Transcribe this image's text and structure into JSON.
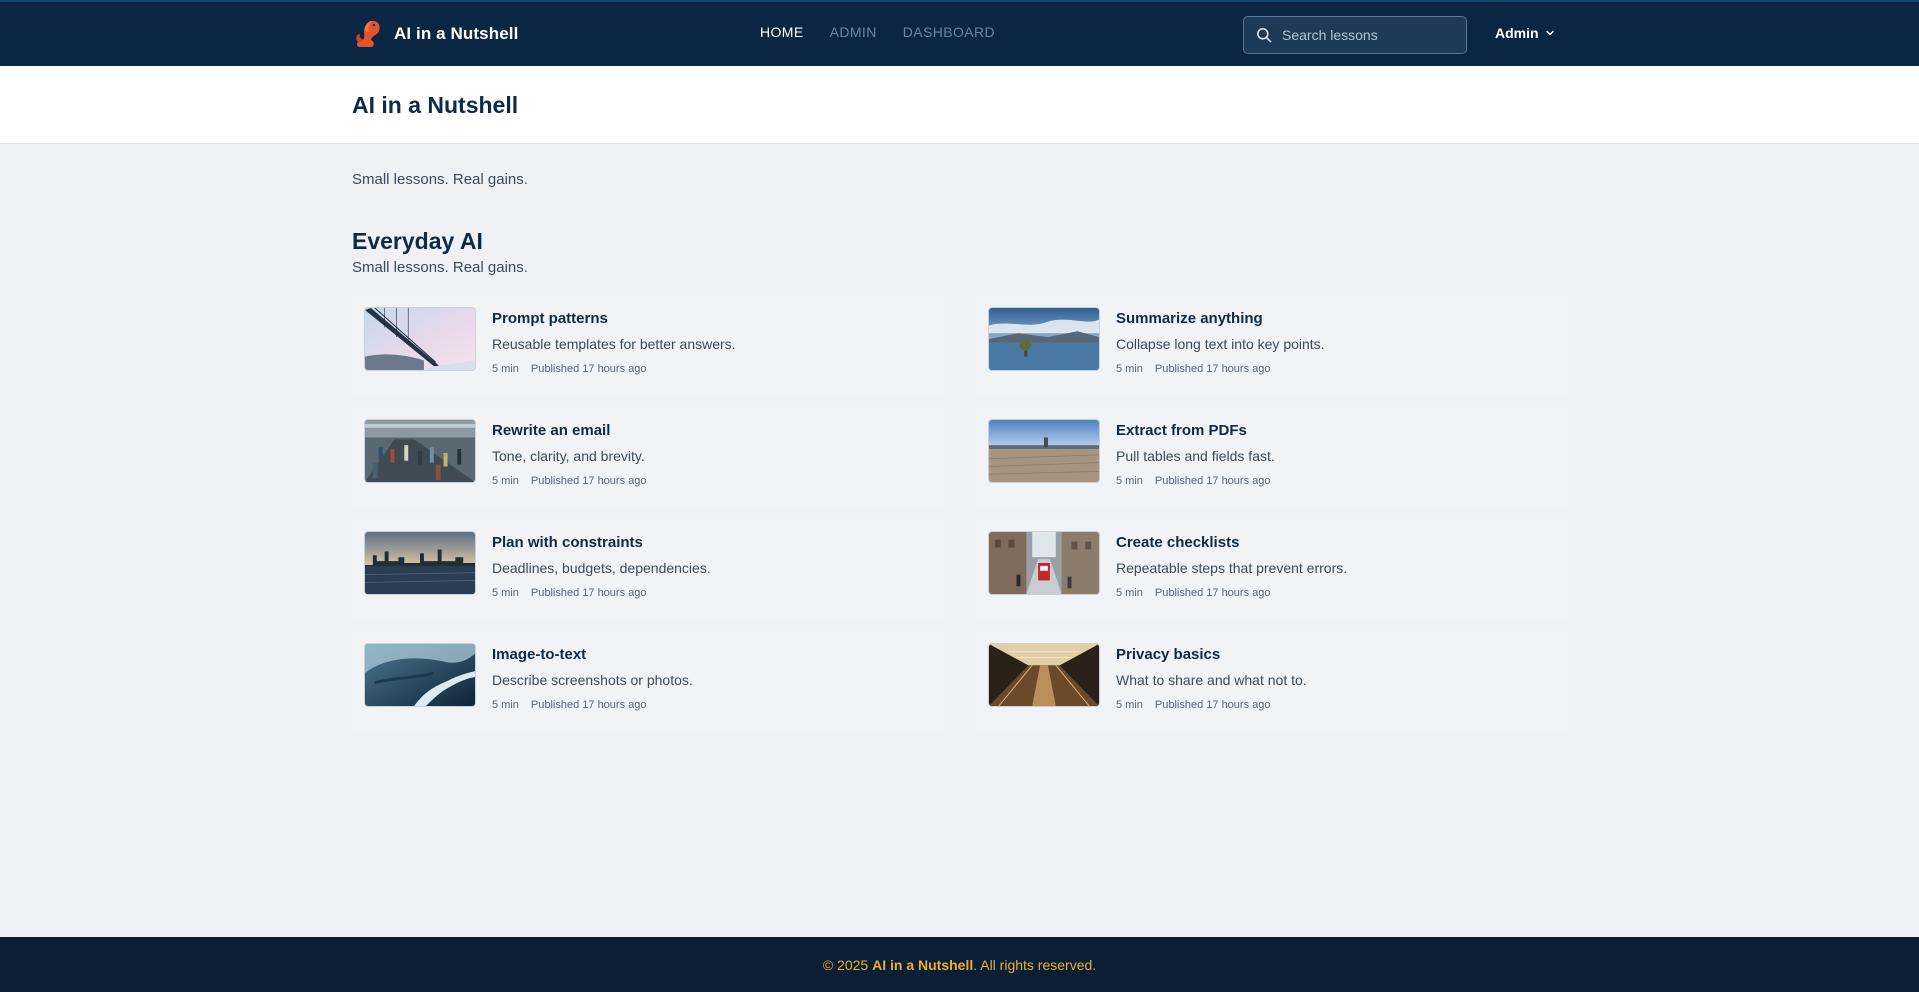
{
  "header": {
    "brand_name": "AI in a Nutshell",
    "nav": [
      {
        "label": "HOME",
        "active": true
      },
      {
        "label": "ADMIN",
        "active": false
      },
      {
        "label": "DASHBOARD",
        "active": false
      }
    ],
    "search_placeholder": "Search lessons",
    "user_label": "Admin"
  },
  "page": {
    "title": "AI in a Nutshell",
    "tagline": "Small lessons. Real gains."
  },
  "section": {
    "title": "Everyday AI",
    "subtitle": "Small lessons. Real gains.",
    "lessons": [
      {
        "title": "Prompt patterns",
        "desc": "Reusable templates for better answers.",
        "duration": "5 min",
        "published": "Published 17 hours ago",
        "image": "bridge-photo"
      },
      {
        "title": "Summarize anything",
        "desc": "Collapse long text into key points.",
        "duration": "5 min",
        "published": "Published 17 hours ago",
        "image": "lake-tree-photo"
      },
      {
        "title": "Rewrite an email",
        "desc": "Tone, clarity, and brevity.",
        "duration": "5 min",
        "published": "Published 17 hours ago",
        "image": "crowd-station-photo"
      },
      {
        "title": "Extract from PDFs",
        "desc": "Pull tables and fields fast.",
        "duration": "5 min",
        "published": "Published 17 hours ago",
        "image": "beach-photo"
      },
      {
        "title": "Plan with constraints",
        "desc": "Deadlines, budgets, dependencies.",
        "duration": "5 min",
        "published": "Published 17 hours ago",
        "image": "city-skyline-photo"
      },
      {
        "title": "Create checklists",
        "desc": "Repeatable steps that prevent errors.",
        "duration": "5 min",
        "published": "Published 17 hours ago",
        "image": "tram-street-photo"
      },
      {
        "title": "Image-to-text",
        "desc": "Describe screenshots or photos.",
        "duration": "5 min",
        "published": "Published 17 hours ago",
        "image": "aerial-river-photo"
      },
      {
        "title": "Privacy basics",
        "desc": "What to share and what not to.",
        "duration": "5 min",
        "published": "Published 17 hours ago",
        "image": "escalator-photo"
      }
    ]
  },
  "footer": {
    "prefix": "© 2025 ",
    "brand": "AI in a Nutshell",
    "suffix": ". All rights reserved."
  },
  "colors": {
    "navbar": "#0b2642",
    "footer": "#0b1e35",
    "footer_text": "#e8b033",
    "logo_accent": "#e0552b"
  }
}
